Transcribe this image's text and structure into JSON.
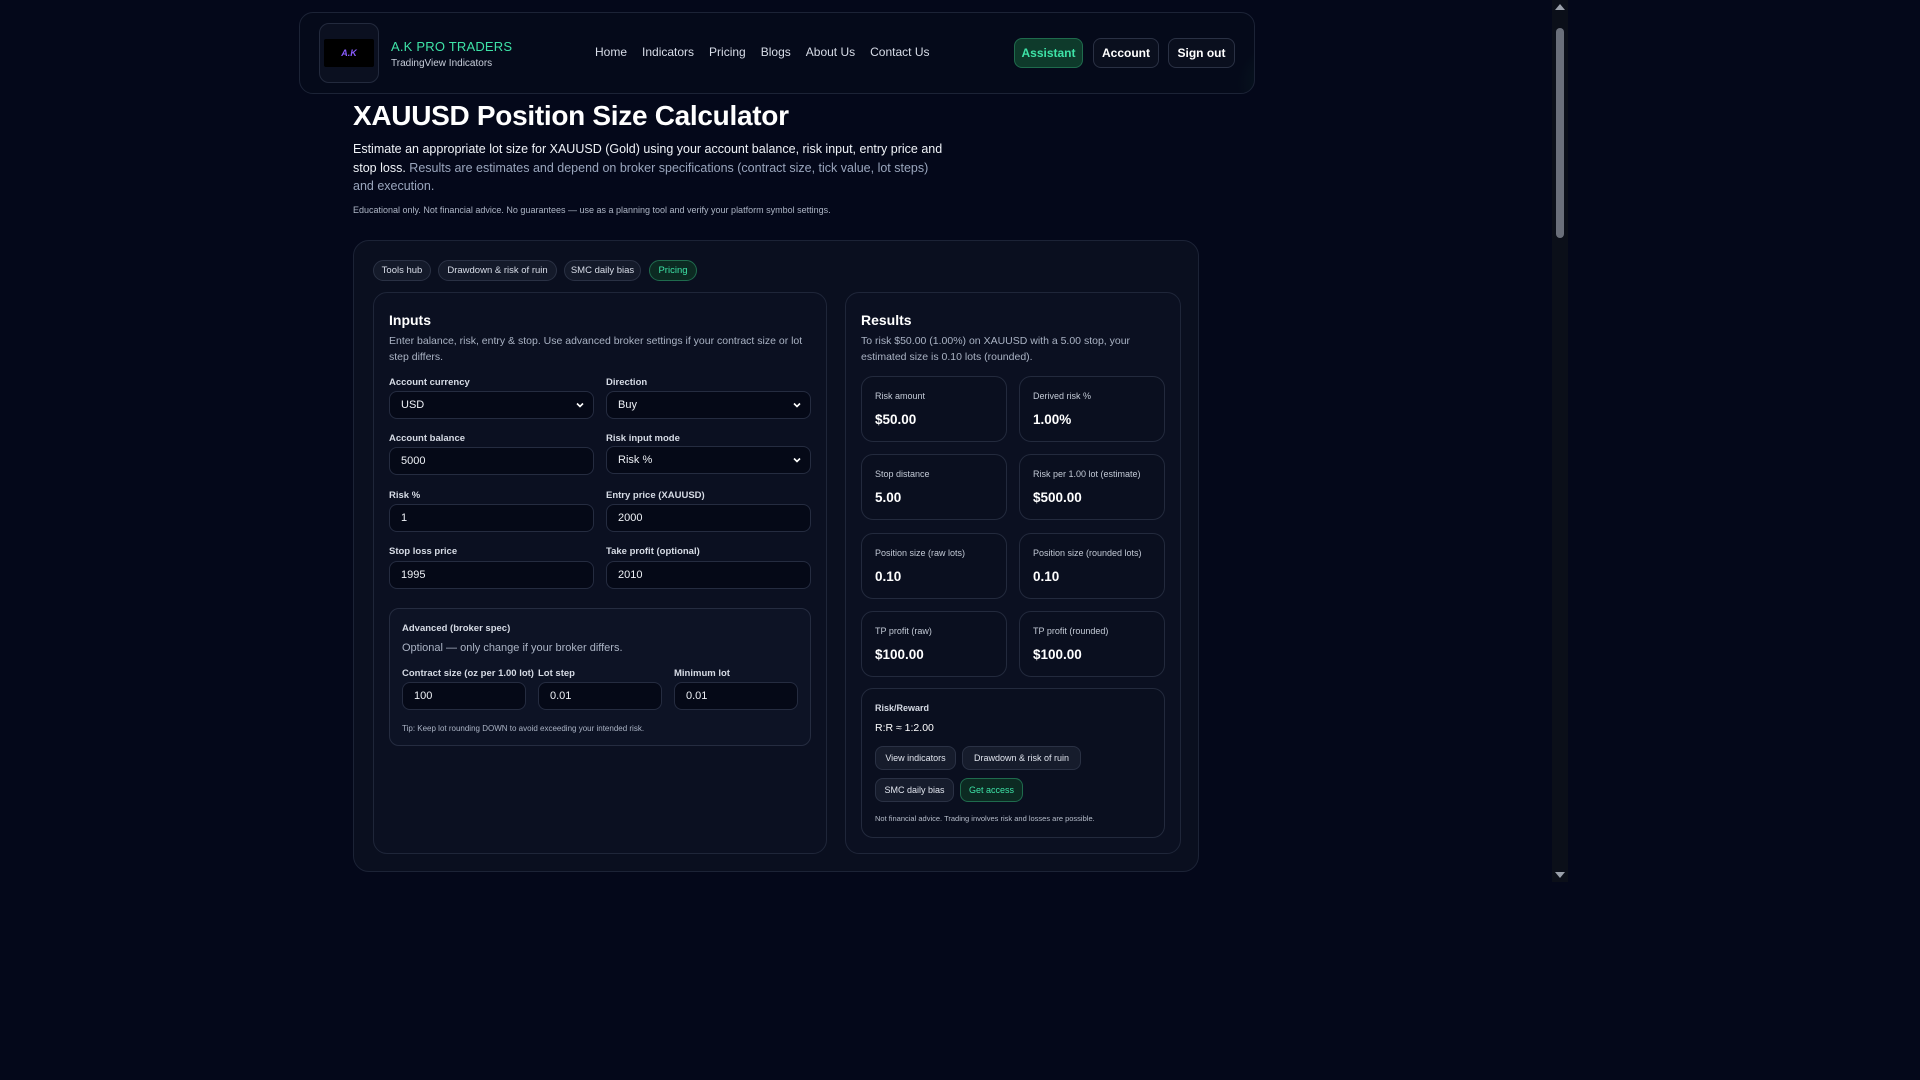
{
  "header": {
    "logo_text": "A.K",
    "brand_title": "A.K PRO TRADERS",
    "brand_sub": "TradingView Indicators",
    "nav": [
      "Home",
      "Indicators",
      "Pricing",
      "Blogs",
      "About Us",
      "Contact Us"
    ],
    "assistant": "Assistant",
    "account": "Account",
    "signout": "Sign out"
  },
  "page": {
    "title": "XAUUSD Position Size Calculator",
    "intro_main": "Estimate an appropriate lot size for XAUUSD (Gold) using your account balance, risk input, entry price and stop loss.",
    "intro_muted": "Results are estimates and depend on broker specifications (contract size, tick value, lot steps) and execution.",
    "disclaimer": "Educational only. Not financial advice. No guarantees — use as a planning tool and verify your platform symbol settings."
  },
  "chips": [
    "Tools hub",
    "Drawdown & risk of ruin",
    "SMC daily bias",
    "Pricing"
  ],
  "inputs": {
    "title": "Inputs",
    "desc": "Enter balance, risk, entry & stop. Use advanced broker settings if your contract size or lot step differs.",
    "account_currency_label": "Account currency",
    "account_currency": "USD",
    "direction_label": "Direction",
    "direction": "Buy",
    "balance_label": "Account balance",
    "balance": "5000",
    "risk_mode_label": "Risk input mode",
    "risk_mode": "Risk %",
    "risk_label": "Risk %",
    "risk": "1",
    "entry_label": "Entry price (XAUUSD)",
    "entry": "2000",
    "stop_label": "Stop loss price",
    "stop": "1995",
    "tp_label": "Take profit (optional)",
    "tp": "2010",
    "advanced": {
      "title": "Advanced (broker spec)",
      "desc": "Optional — only change if your broker differs.",
      "contract_label": "Contract size (oz per 1.00 lot)",
      "contract": "100",
      "lot_step_label": "Lot step",
      "lot_step": "0.01",
      "min_lot_label": "Minimum lot",
      "min_lot": "0.01",
      "tip": "Tip: Keep lot rounding DOWN to avoid exceeding your intended risk."
    }
  },
  "results": {
    "title": "Results",
    "summary": "To risk $50.00 (1.00%) on XAUUSD with a 5.00 stop, your estimated size is 0.10 lots (rounded).",
    "stats": [
      {
        "label": "Risk amount",
        "value": "$50.00"
      },
      {
        "label": "Derived risk %",
        "value": "1.00%"
      },
      {
        "label": "Stop distance",
        "value": "5.00"
      },
      {
        "label": "Risk per 1.00 lot (estimate)",
        "value": "$500.00"
      },
      {
        "label": "Position size (raw lots)",
        "value": "0.10"
      },
      {
        "label": "Position size (rounded lots)",
        "value": "0.10"
      },
      {
        "label": "TP profit (raw)",
        "value": "$100.00"
      },
      {
        "label": "TP profit (rounded)",
        "value": "$100.00"
      }
    ],
    "rr": {
      "title": "Risk/Reward",
      "value": "R:R ≈ 1:2.00",
      "buttons": [
        "View indicators",
        "Drawdown & risk of ruin",
        "SMC daily bias",
        "Get access"
      ],
      "note": "Not financial advice. Trading involves risk and losses are possible."
    }
  },
  "colors": {
    "accent": "#3ee3a7",
    "background": "#04081a",
    "panel": "#0a0f1f"
  }
}
